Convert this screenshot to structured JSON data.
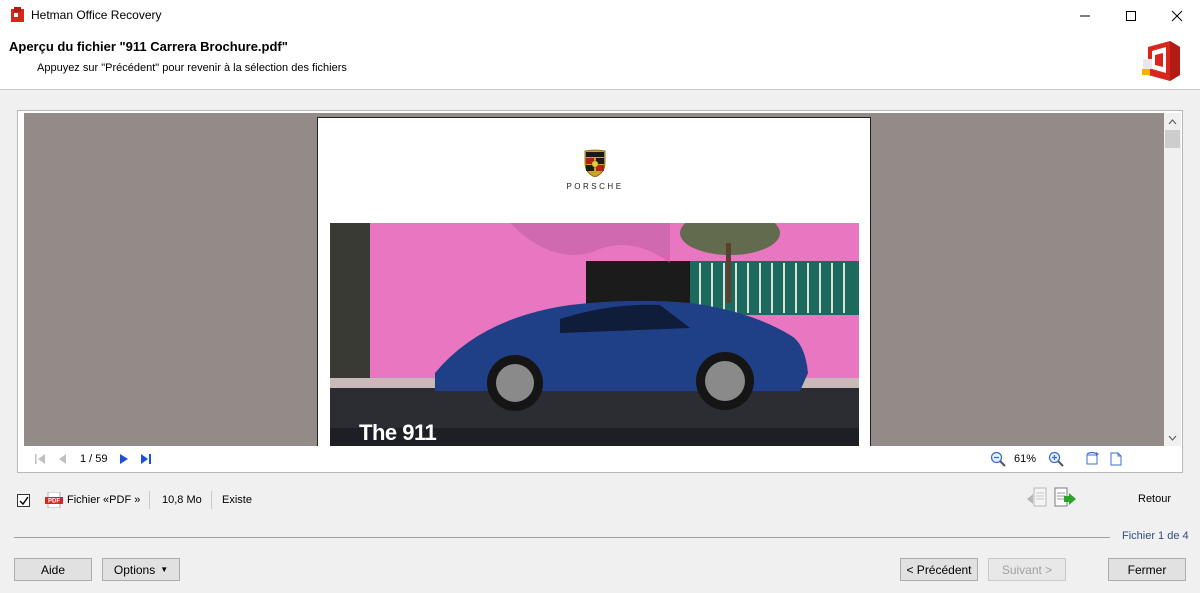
{
  "window": {
    "title": "Hetman Office Recovery",
    "controls": [
      "minimize-icon",
      "maximize-icon",
      "close-icon"
    ]
  },
  "header": {
    "title": "Aperçu du fichier \"911 Carrera Brochure.pdf\"",
    "subtitle": "Appuyez sur \"Précédent\" pour revenir à la sélection des fichiers",
    "logo": "hetman-office-logo-icon"
  },
  "preview": {
    "brand_word": "PORSCHE",
    "caption": "The 911",
    "page_counter": "1 / 59",
    "zoom": "61%",
    "nav_icons": [
      "first-page-icon",
      "previous-page-icon",
      "next-page-icon",
      "last-page-icon"
    ],
    "view_icons": [
      "zoom-out-icon",
      "zoom-in-icon",
      "rotate-icon",
      "fit-page-icon"
    ]
  },
  "file": {
    "checked": true,
    "type_label": "Fichier «PDF »",
    "size": "10,8 Mo",
    "status": "Existe",
    "retour_label": "Retour",
    "counter": "Fichier 1 de 4"
  },
  "buttons": {
    "aide": "Aide",
    "options": "Options",
    "precedent": "< Précédent",
    "suivant": "Suivant >",
    "fermer": "Fermer"
  },
  "colors": {
    "canvas_bg": "#928b88",
    "accent_red": "#d9261c",
    "nav_blue": "#1e4fd8",
    "counter_text": "#2f4f7f"
  }
}
